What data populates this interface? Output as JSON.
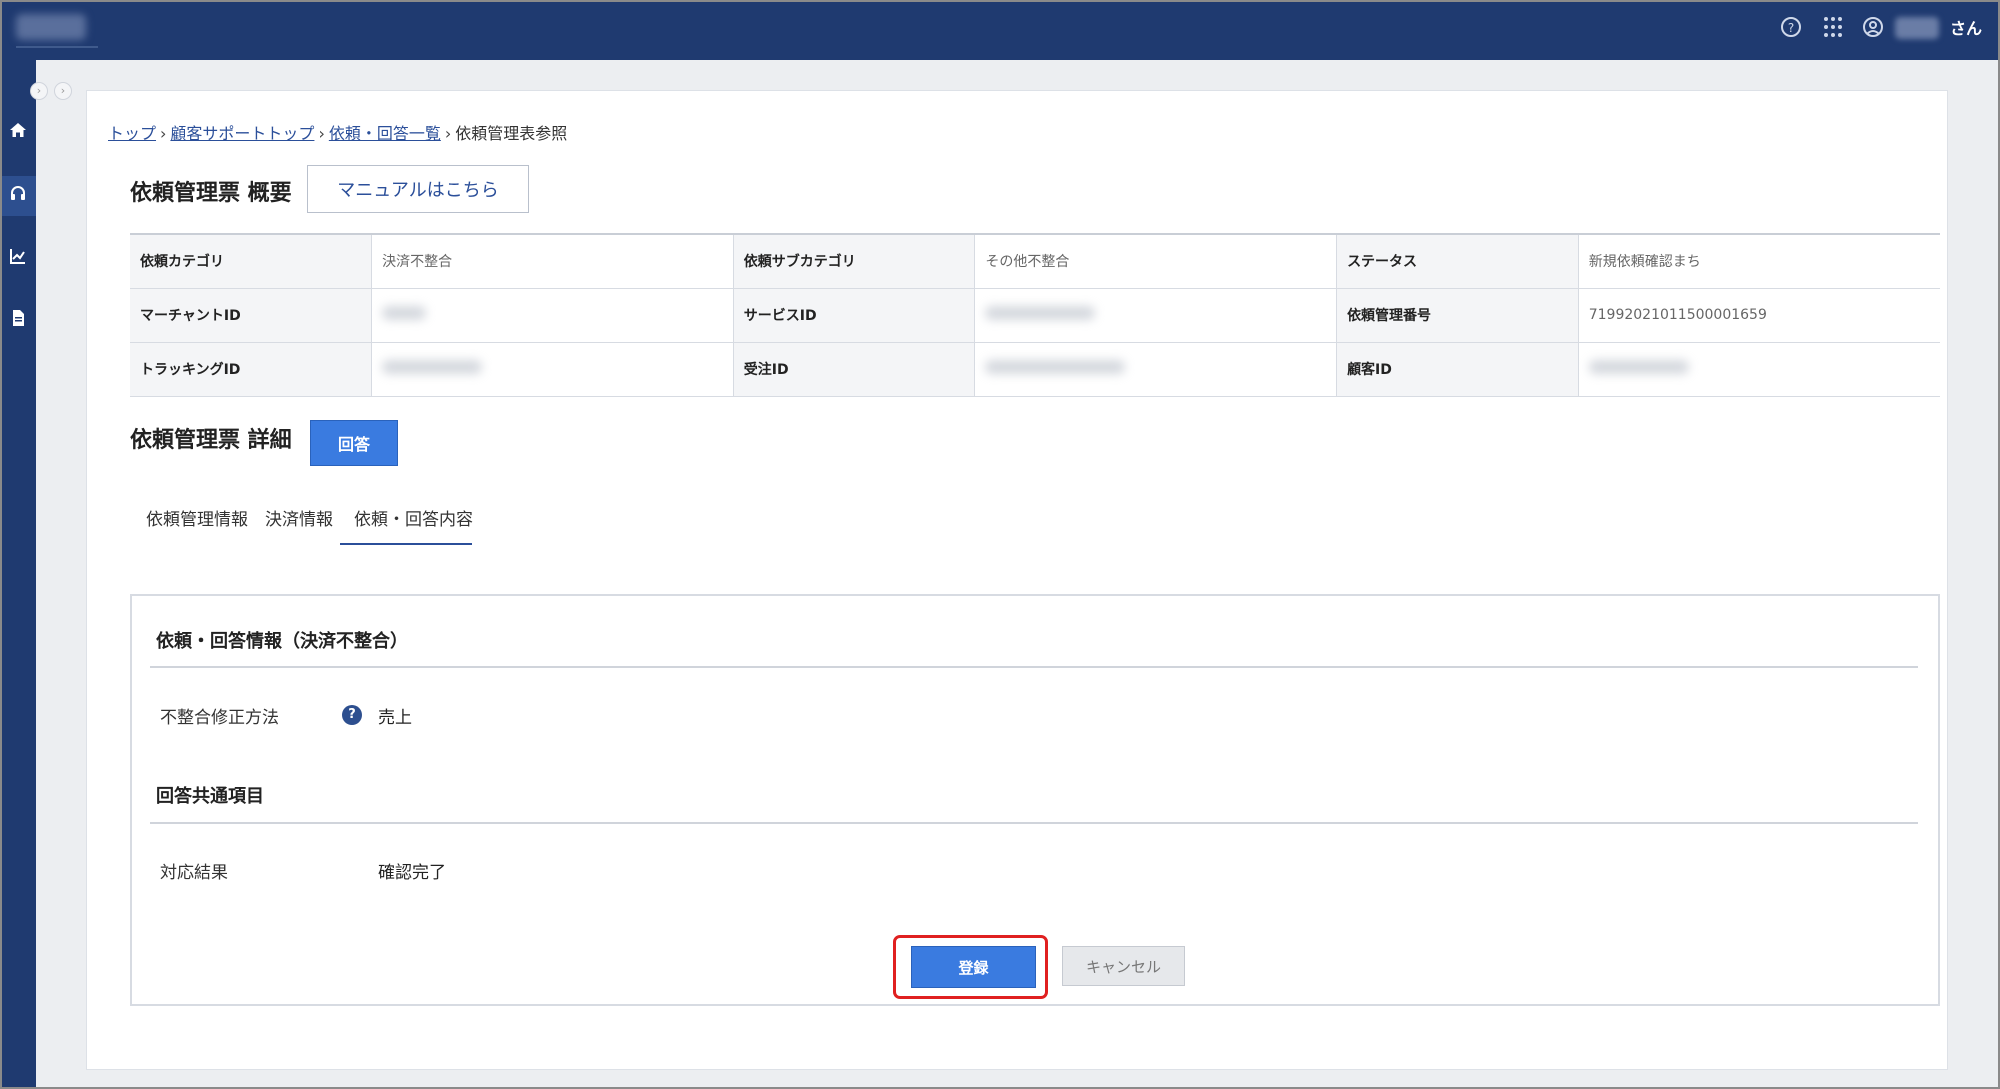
{
  "header": {
    "user_suffix": "さん",
    "icons": [
      "help-icon",
      "apps-grid-icon",
      "user-icon"
    ]
  },
  "sidebar": {
    "items": [
      {
        "icon": "home-icon"
      },
      {
        "icon": "headset-support-icon",
        "active": true
      },
      {
        "icon": "chart-icon"
      },
      {
        "icon": "document-icon"
      }
    ]
  },
  "breadcrumb": {
    "items": [
      "トップ",
      "顧客サポートトップ",
      "依頼・回答一覧",
      "依頼管理表参照"
    ],
    "separator": "›"
  },
  "summary": {
    "title": "依頼管理票 概要",
    "manual_button": "マニュアルはこちら",
    "rows": [
      [
        {
          "label": "依頼カテゴリ",
          "value": "決済不整合"
        },
        {
          "label": "依頼サブカテゴリ",
          "value": "その他不整合"
        },
        {
          "label": "ステータス",
          "value": "新規依頼確認まち"
        }
      ],
      [
        {
          "label": "マーチャントID",
          "value": ""
        },
        {
          "label": "サービスID",
          "value": ""
        },
        {
          "label": "依頼管理番号",
          "value": "71992021011500001659"
        }
      ],
      [
        {
          "label": "トラッキングID",
          "value": ""
        },
        {
          "label": "受注ID",
          "value": ""
        },
        {
          "label": "顧客ID",
          "value": ""
        }
      ]
    ]
  },
  "detail": {
    "title": "依頼管理票 詳細",
    "reply_button": "回答",
    "tabs": [
      "依頼管理情報",
      "決済情報",
      "依頼・回答内容"
    ],
    "active_tab": 2
  },
  "panel": {
    "section1_title": "依頼・回答情報（決済不整合）",
    "fix_method_label": "不整合修正方法",
    "fix_method_value": "売上",
    "section2_title": "回答共通項目",
    "result_label": "対応結果",
    "result_value": "確認完了",
    "register_button": "登録",
    "cancel_button": "キャンセル"
  },
  "colors": {
    "header_bg": "#1f3a70",
    "primary_button": "#3a7be0",
    "highlight_border": "#e02020"
  }
}
